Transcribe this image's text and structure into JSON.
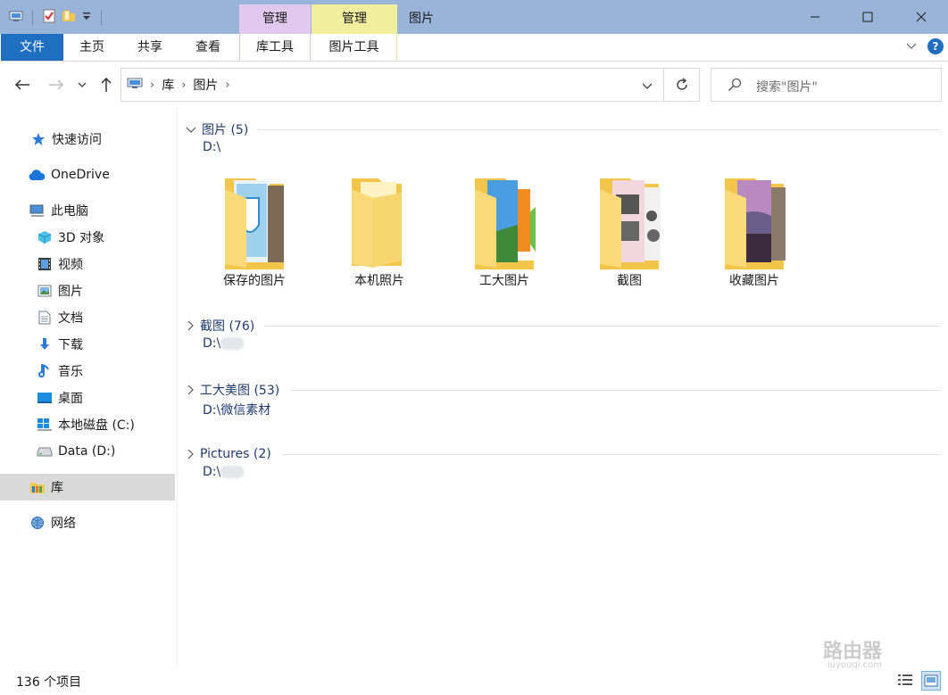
{
  "window": {
    "title": "图片",
    "context_tab_manage_library": "管理",
    "context_tab_manage_pictures": "管理",
    "minimize_glyph": "─",
    "maximize_glyph": "☐",
    "close_glyph": "✕"
  },
  "ribbon": {
    "tabs": [
      "文件",
      "主页",
      "共享",
      "查看",
      "库工具",
      "图片工具"
    ],
    "help_glyph": "?"
  },
  "address": {
    "crumbs": [
      "库",
      "图片"
    ],
    "search_placeholder": "搜索\"图片\""
  },
  "sidebar": {
    "items": [
      {
        "label": "快速访问",
        "icon": "star-icon"
      },
      {
        "label": "OneDrive",
        "icon": "cloud-icon"
      },
      {
        "label": "此电脑",
        "icon": "computer-icon"
      },
      {
        "label": "3D 对象",
        "icon": "cube-icon"
      },
      {
        "label": "视频",
        "icon": "film-icon"
      },
      {
        "label": "图片",
        "icon": "pictures-icon"
      },
      {
        "label": "文档",
        "icon": "document-icon"
      },
      {
        "label": "下载",
        "icon": "download-icon"
      },
      {
        "label": "音乐",
        "icon": "music-icon"
      },
      {
        "label": "桌面",
        "icon": "desktop-icon"
      },
      {
        "label": "本地磁盘 (C:)",
        "icon": "windows-drive-icon"
      },
      {
        "label": "Data (D:)",
        "icon": "drive-icon"
      },
      {
        "label": "库",
        "icon": "library-icon"
      },
      {
        "label": "网络",
        "icon": "network-icon"
      }
    ],
    "selected": "库"
  },
  "groups": [
    {
      "title": "图片 (5)",
      "path": "D:\\",
      "expanded": true
    },
    {
      "title": "截图 (76)",
      "path": "D:\\",
      "expanded": false
    },
    {
      "title": "工大美图 (53)",
      "path": "D:\\微信素材",
      "expanded": false
    },
    {
      "title": "Pictures (2)",
      "path": "D:\\",
      "expanded": false
    }
  ],
  "folders": [
    {
      "label": "保存的图片"
    },
    {
      "label": "本机照片"
    },
    {
      "label": "工大图片"
    },
    {
      "label": "截图"
    },
    {
      "label": "收藏图片"
    }
  ],
  "status": {
    "count": "136 个项目"
  },
  "watermark": {
    "text": "路由器",
    "sub": "luyouqi.com"
  },
  "colors": {
    "titlebar": "#99b4d8",
    "file_tab": "#1f6fc1",
    "context_purple": "#e0c8ee",
    "context_yellow": "#f1ee9e",
    "group_title": "#1e3a6e",
    "folder_yellow": "#f7d670"
  }
}
